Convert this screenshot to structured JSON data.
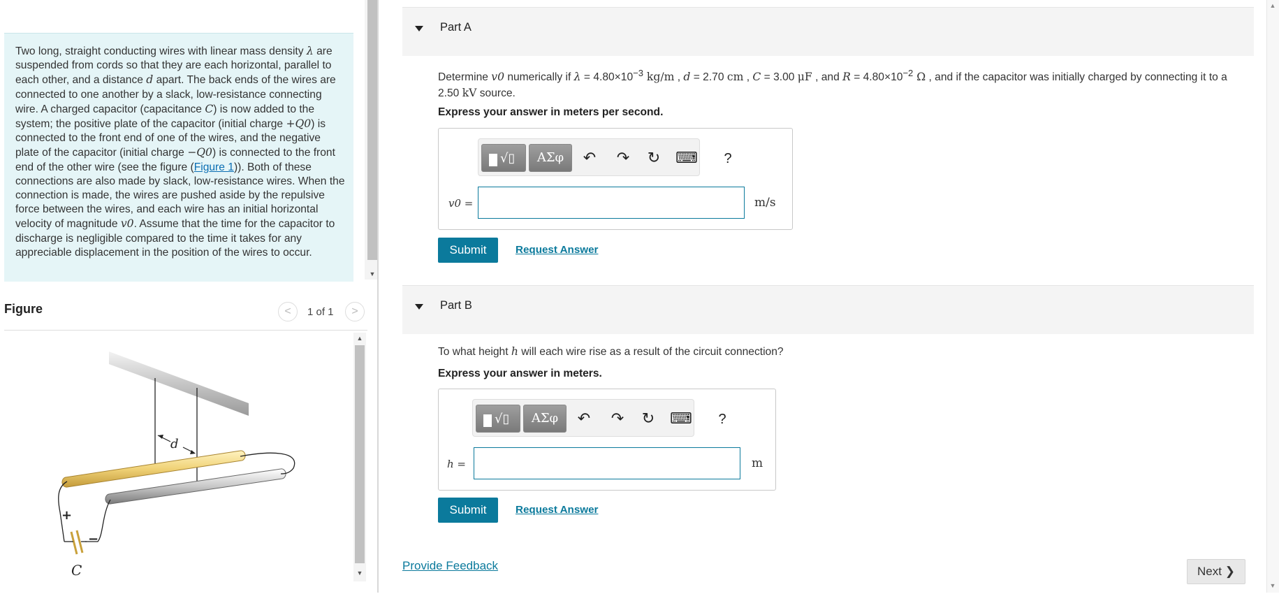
{
  "problem": {
    "p1": "Two long, straight conducting wires with linear mass density ",
    "lambda": "λ",
    "p2": " are suspended from cords so that they are each horizontal, parallel to each other, and a distance ",
    "d": "d",
    "p3": " apart. The back ends of the wires are connected to one another by a slack, low-resistance connecting wire. A charged capacitor (capacitance ",
    "C": "C",
    "p4": ") is now added to the system; the positive plate of the capacitor (initial charge ",
    "plusQ0": "+Q0",
    "p5": ") is connected to the front end of one of the wires, and the negative plate of the capacitor (initial charge ",
    "minusQ0": "−Q0",
    "p6": ") is connected to the front end of the other wire (see the figure (",
    "figure_link": "Figure 1",
    "p7": ")). Both of these connections are also made by slack, low-resistance wires. When the connection is made, the wires are pushed aside by the repulsive force between the wires, and each wire has an initial horizontal velocity of magnitude ",
    "v0": "v0",
    "p8": ". Assume that the time for the capacitor to discharge is negligible compared to the time it takes for any appreciable displacement in the position of the wires to occur."
  },
  "figure": {
    "title": "Figure",
    "pager": "1 of 1",
    "prev_icon": "<",
    "next_icon": ">",
    "label_d": "d",
    "label_C": "C",
    "label_plus": "+",
    "label_minus": "−"
  },
  "partA": {
    "title": "Part A",
    "q_pre": "Determine ",
    "q_v0": "v0",
    "q_numerically": " numerically if ",
    "q_lambda": "λ",
    "q_lambda_val": " = 4.80×10",
    "q_lambda_exp": "−3",
    "q_lambda_unit": " kg/m",
    "q_sep1": " , ",
    "q_d": "d",
    "q_d_val": " = 2.70 ",
    "q_d_unit": "cm",
    "q_sep2": " , ",
    "q_C": "C",
    "q_C_val": " = 3.00 ",
    "q_C_unit": "μF",
    "q_sep3": " , and ",
    "q_R": "R",
    "q_R_val": " = 4.80×10",
    "q_R_exp": "−2",
    "q_R_unit": " Ω",
    "q_tail": " , and if the capacitor was initially charged by connecting it to a 2.50 ",
    "q_kV": "kV",
    "q_source": " source.",
    "instruction": "Express your answer in meters per second.",
    "var_label": "v0 =",
    "unit": "m/s",
    "answer_value": "",
    "submit": "Submit",
    "request": "Request Answer"
  },
  "partB": {
    "title": "Part B",
    "q_pre": "To what height ",
    "q_h": "h",
    "q_post": " will each wire rise as a result of the circuit connection?",
    "instruction": "Express your answer in meters.",
    "var_label": "h =",
    "unit": "m",
    "answer_value": "",
    "submit": "Submit",
    "request": "Request Answer"
  },
  "toolbar": {
    "greek": "ΑΣφ",
    "undo_icon": "↶",
    "redo_icon": "↷",
    "reset_icon": "↻",
    "keyboard_icon": "⌨",
    "help": "?"
  },
  "footer": {
    "feedback": "Provide Feedback",
    "next": "Next"
  }
}
